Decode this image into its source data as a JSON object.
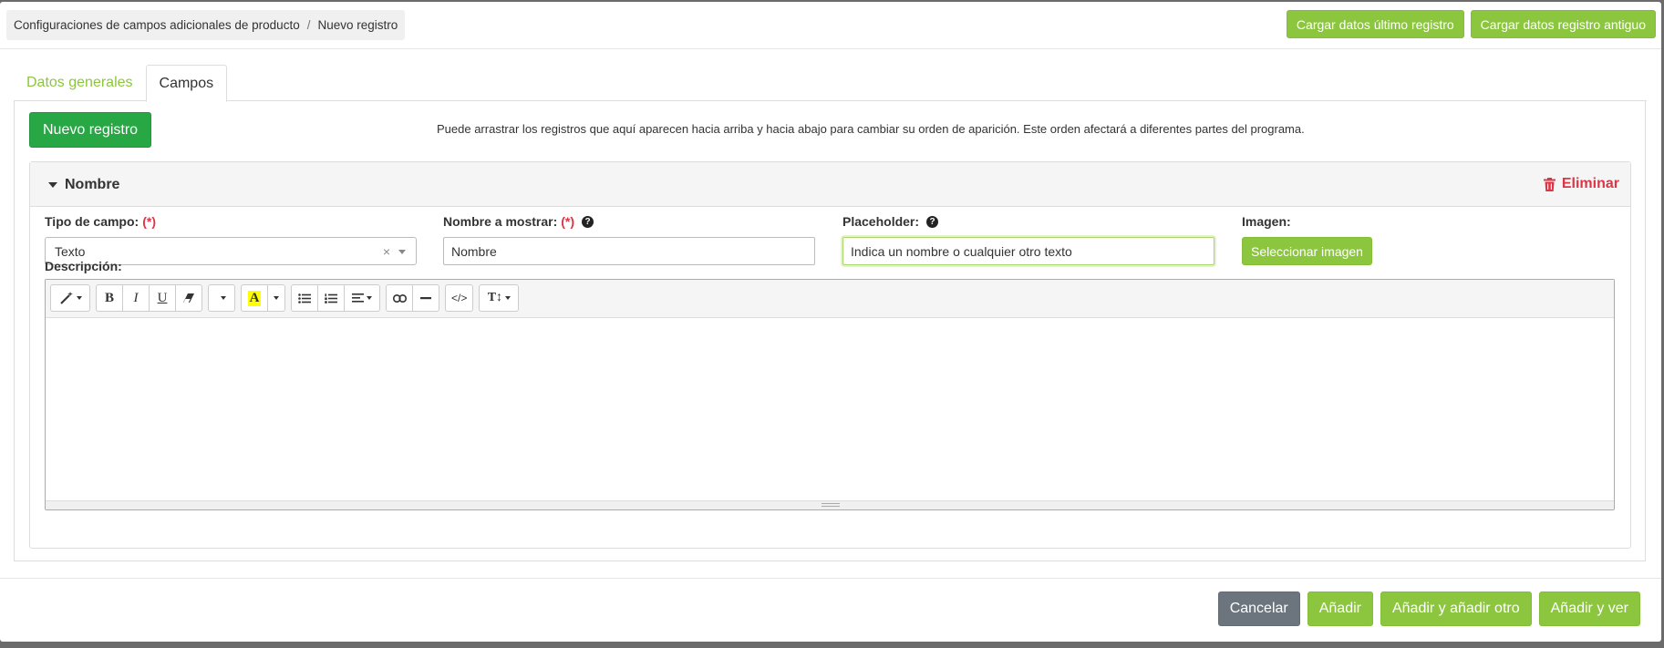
{
  "breadcrumb": {
    "parent": "Configuraciones de campos adicionales de producto",
    "separator": "/",
    "current": "Nuevo registro"
  },
  "header_actions": {
    "load_last": "Cargar datos último registro",
    "load_old": "Cargar datos registro antiguo"
  },
  "tabs": [
    {
      "label": "Datos generales",
      "active": false
    },
    {
      "label": "Campos",
      "active": true
    }
  ],
  "panel": {
    "new_record_label": "Nuevo registro",
    "hint": "Puede arrastrar los registros que aquí aparecen hacia arriba y hacia abajo para cambiar su orden de aparición. Este orden afectará a diferentes partes del programa."
  },
  "record": {
    "title": "Nombre",
    "delete_label": "Eliminar",
    "field_type": {
      "label": "Tipo de campo:",
      "required": "(*)",
      "value": "Texto",
      "clear": "×"
    },
    "display_name": {
      "label": "Nombre a mostrar:",
      "required": "(*)",
      "value": "Nombre"
    },
    "placeholder": {
      "label": "Placeholder:",
      "value": "Indica un nombre o cualquier otro texto"
    },
    "image": {
      "label": "Imagen:",
      "button": "Seleccionar imagen"
    },
    "description": {
      "label": "Descripción:"
    }
  },
  "toolbar": {
    "bold": "B",
    "italic": "I",
    "underline": "U",
    "code": "</>",
    "textsize": "T↕",
    "highlight": "A"
  },
  "colors": {
    "accent_green": "#8cc63f",
    "primary_green": "#28a745",
    "danger": "#dc3545",
    "cancel_gray": "#6c757d"
  },
  "footer": {
    "cancel": "Cancelar",
    "add": "Añadir",
    "add_another": "Añadir y añadir otro",
    "add_view": "Añadir y ver"
  }
}
